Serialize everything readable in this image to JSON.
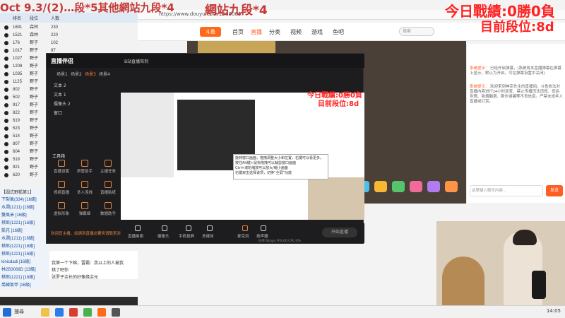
{
  "banner": {
    "title_left": "Oct 9.3/(2)…段*5其他網站九段*4",
    "title_main": "網站九段*4",
    "record_right": "今日戰績:0勝0負",
    "rank_right": "目前段位:8d",
    "record_small": "今日戰績:0勝0負",
    "rank_small": "目前段位:8d"
  },
  "browser": {
    "url": "https://www.douyu.com/2268066",
    "nav": [
      "首页",
      "直播",
      "分类",
      "视频",
      "游戏",
      "鱼吧"
    ],
    "logo": "斗鱼",
    "search_placeholder": "搜索"
  },
  "chat": {
    "lines": [
      {
        "sys": "系统提示：",
        "text": "已经开启弹幕，(系统将本直播弹幕在屏幕上显示，默认为开启。可在弹幕设置中关闭)"
      },
      {
        "sys": "系统提示：",
        "text": "欢迎来到神宗先生的直播间。斗鱼依法对直播内容进行24小时巡查，禁止传播违法违规、低俗色情、吸烟酗酒、欺诈诱骗等不良信息。严禁未成年人直播或打赏。"
      }
    ],
    "input_placeholder": "这里输入聊天内容…",
    "send_label": "发送"
  },
  "ranklist": {
    "headers": [
      "排名",
      "段位",
      "人数"
    ],
    "rows": [
      {
        "n": "1691",
        "name": "森林",
        "v": "230"
      },
      {
        "n": "1521",
        "name": "森林",
        "v": "220"
      },
      {
        "n": "176",
        "name": "野子",
        "v": "102"
      },
      {
        "n": "1017",
        "name": "野子",
        "v": "97"
      },
      {
        "n": "1027",
        "name": "野子",
        "v": "97"
      },
      {
        "n": "1208",
        "name": "野子",
        "v": "94"
      },
      {
        "n": "1035",
        "name": "野子",
        "v": "90"
      },
      {
        "n": "1125",
        "name": "野子",
        "v": "89"
      },
      {
        "n": "802",
        "name": "野子",
        "v": "89"
      },
      {
        "n": "502",
        "name": "野子",
        "v": "86"
      },
      {
        "n": "917",
        "name": "野子",
        "v": "86"
      },
      {
        "n": "822",
        "name": "野子",
        "v": "83"
      },
      {
        "n": "619",
        "name": "野子",
        "v": "83"
      },
      {
        "n": "523",
        "name": "野子",
        "v": "82"
      },
      {
        "n": "514",
        "name": "野子",
        "v": "82"
      },
      {
        "n": "807",
        "name": "野子",
        "v": "80"
      },
      {
        "n": "604",
        "name": "野子",
        "v": "80"
      },
      {
        "n": "518",
        "name": "野子",
        "v": "79"
      },
      {
        "n": "921",
        "name": "野子",
        "v": "79"
      },
      {
        "n": "620",
        "name": "野子",
        "v": "78"
      }
    ]
  },
  "userlist": {
    "title": "【圍式野狐第1】",
    "users": [
      "下梨氣(334) [16級]",
      "水澗(1211) [16級]",
      "雙風米 [16級]",
      "棋郎(1221) [16級]",
      "凱花 [16級]",
      "水澗(1211) [16級]",
      "棋郎(1221) [16級]",
      "棋郎(1221) [16級]",
      "kinicdadi [16級]",
      "林2B3068D [13級]",
      "棋郎(1221) [16級]",
      "喬練氣甲 [16級]"
    ],
    "chat": [
      "我第一个下棉，雷霸：我以上的人被我",
      "棋了吧你",
      "张罗子余长的好像缘余元"
    ]
  },
  "companion": {
    "logo": "直播伴侣",
    "tabs": [
      "场景1",
      "场景2",
      "场景3",
      "场景4"
    ],
    "room_title": "B站直播驾到",
    "sources": [
      "文本 2",
      "文本 1",
      "摄像头 2",
      "窗口"
    ],
    "tools_title": "工具箱",
    "tools": [
      "直播设置",
      "房管助手",
      "主播任务",
      "视频直播",
      "多人连线",
      "直播贴纸",
      "虚拟形象",
      "弹幕姬",
      "数据助手"
    ],
    "bottom": [
      "直播画面",
      "摄像头",
      "手机投屏",
      "多媒体",
      "麦克风",
      "扬声器"
    ],
    "start_label": "开始直播",
    "stats": "码率:0kbps   FPS:60   CPU:0%",
    "notice": "欢迎您主播，如遇到直播必要务请联系对客服"
  },
  "popup": {
    "lines": [
      "旋转窗口画面，拖拽调整大小和位置，右键可以看更多。",
      "按住Alt键+鼠标拖拽可以裁剪窗口画面",
      "Ctrl+滚轮缩放可以放大/缩小画面",
      "右键双击选择该项，切换“全屏”功能"
    ]
  },
  "taskbar": {
    "search_label": "搜尋",
    "clock": "14:05"
  },
  "colors": {
    "accent": "#ff5d23",
    "overlay_red": "#ff2222",
    "banner_red": "#c43838"
  }
}
